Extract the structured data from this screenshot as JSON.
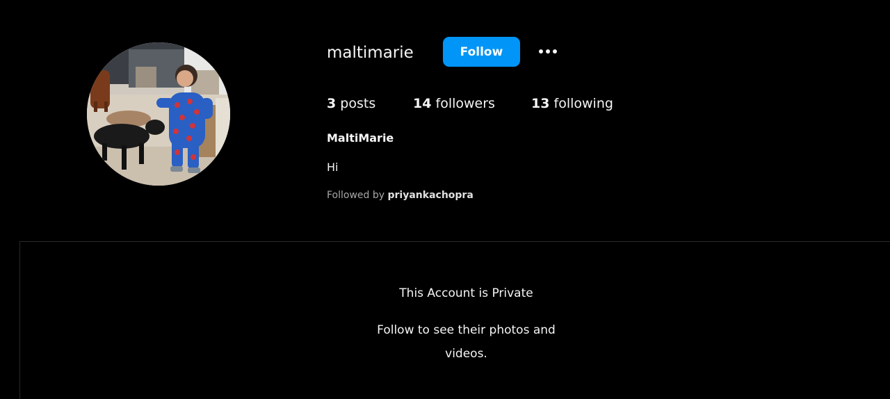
{
  "profile": {
    "username": "maltimarie",
    "follow_label": "Follow",
    "more_icon": "more-horizontal-icon",
    "stats": {
      "posts_count": "3",
      "posts_label": "posts",
      "followers_count": "14",
      "followers_label": "followers",
      "following_count": "13",
      "following_label": "following"
    },
    "full_name": "MaltiMarie",
    "bio": "Hi",
    "followed_by_prefix": "Followed by",
    "followed_by_user": "priyankachopra"
  },
  "private_notice": {
    "title": "This Account is Private",
    "description_line1": "Follow to see their photos and",
    "description_line2": "videos."
  },
  "colors": {
    "background": "#000000",
    "accent": "#0095f6",
    "text": "#f5f5f5",
    "muted": "#a8a8a8"
  }
}
